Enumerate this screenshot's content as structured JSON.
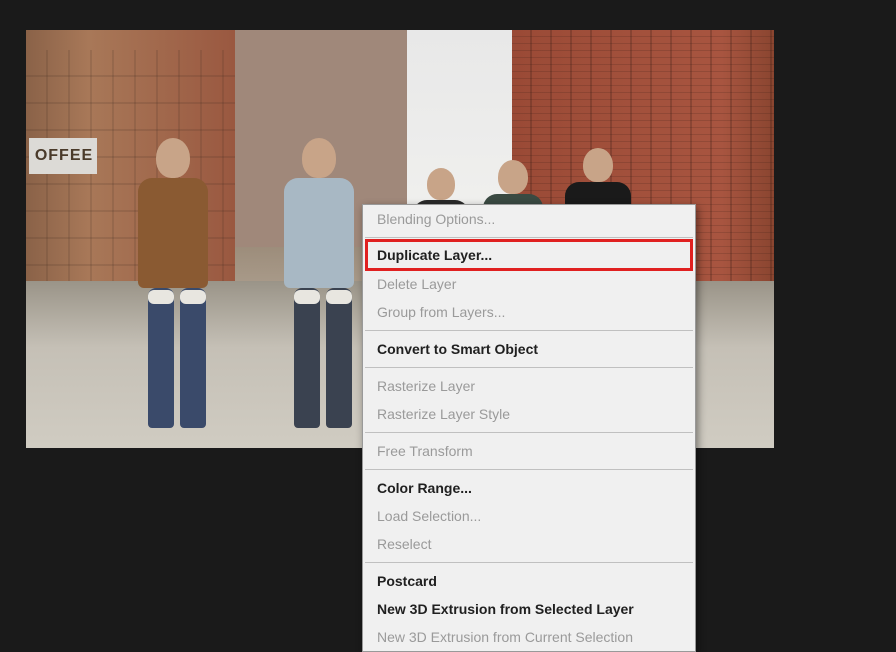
{
  "canvas": {
    "sign_text": "OFFEE"
  },
  "menu": {
    "blending_options": "Blending Options...",
    "duplicate_layer": "Duplicate Layer...",
    "delete_layer": "Delete Layer",
    "group_from_layers": "Group from Layers...",
    "convert_smart": "Convert to Smart Object",
    "rasterize_layer": "Rasterize Layer",
    "rasterize_style": "Rasterize Layer Style",
    "free_transform": "Free Transform",
    "color_range": "Color Range...",
    "load_selection": "Load Selection...",
    "reselect": "Reselect",
    "postcard": "Postcard",
    "new_3d_selected": "New 3D Extrusion from Selected Layer",
    "new_3d_current": "New 3D Extrusion from Current Selection"
  }
}
